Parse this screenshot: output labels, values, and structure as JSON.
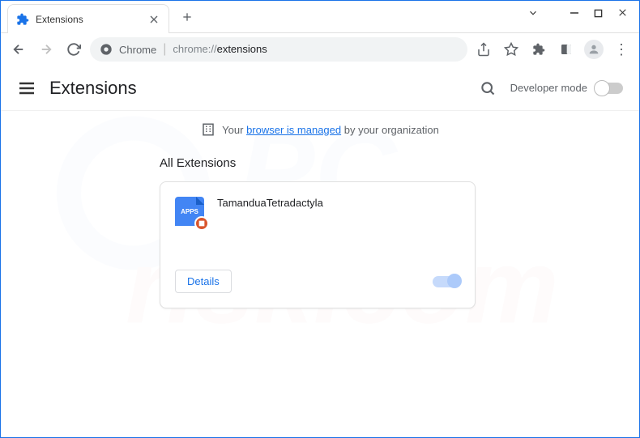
{
  "tab": {
    "title": "Extensions"
  },
  "address": {
    "prefix": "Chrome",
    "dim": "chrome://",
    "bold": "extensions"
  },
  "header": {
    "title": "Extensions",
    "dev_mode": "Developer mode"
  },
  "banner": {
    "pre": "Your ",
    "link": "browser is managed",
    "post": " by your organization"
  },
  "section": {
    "title": "All Extensions"
  },
  "ext": {
    "name": "TamanduaTetradactyla",
    "icon_text": "APPS",
    "details": "Details"
  }
}
